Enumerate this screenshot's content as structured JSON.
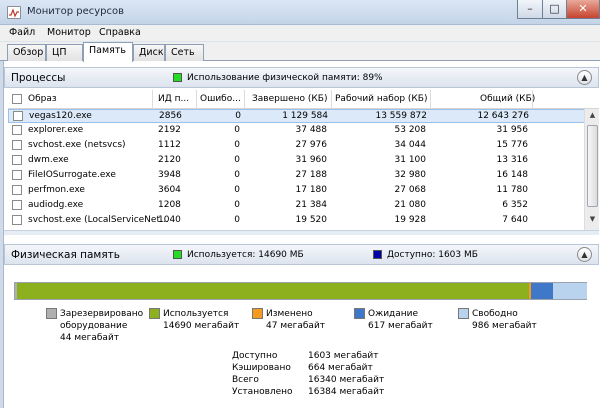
{
  "window": {
    "title": "Монитор ресурсов"
  },
  "menu": [
    "Файл",
    "Монитор",
    "Справка"
  ],
  "tabs": [
    "Обзор",
    "ЦП",
    "Память",
    "Диск",
    "Сеть"
  ],
  "processes": {
    "title": "Процессы",
    "usage_text": "Использование физической памяти: 89%",
    "usage_color": "#22dd22",
    "columns": [
      "Образ",
      "ИД п...",
      "Ошибо...",
      "Завершено (КБ)",
      "Рабочий набор (КБ)",
      "Общий (КБ)"
    ],
    "rows": [
      {
        "image": "vegas120.exe",
        "pid": "2856",
        "faults": "0",
        "commit": "1 129 584",
        "working": "13 559 872",
        "shareable": "12 643 276"
      },
      {
        "image": "explorer.exe",
        "pid": "2192",
        "faults": "0",
        "commit": "37 488",
        "working": "53 208",
        "shareable": "31 956"
      },
      {
        "image": "svchost.exe (netsvcs)",
        "pid": "1112",
        "faults": "0",
        "commit": "27 976",
        "working": "34 044",
        "shareable": "15 776"
      },
      {
        "image": "dwm.exe",
        "pid": "2120",
        "faults": "0",
        "commit": "31 960",
        "working": "31 100",
        "shareable": "13 316"
      },
      {
        "image": "FileIOSurrogate.exe",
        "pid": "3948",
        "faults": "0",
        "commit": "27 188",
        "working": "32 980",
        "shareable": "16 148"
      },
      {
        "image": "perfmon.exe",
        "pid": "3604",
        "faults": "0",
        "commit": "17 180",
        "working": "27 068",
        "shareable": "11 780"
      },
      {
        "image": "audiodg.exe",
        "pid": "1208",
        "faults": "0",
        "commit": "21 384",
        "working": "21 080",
        "shareable": "6 352"
      },
      {
        "image": "svchost.exe (LocalServiceNet...",
        "pid": "1040",
        "faults": "0",
        "commit": "19 520",
        "working": "19 928",
        "shareable": "7 640"
      }
    ]
  },
  "physical": {
    "title": "Физическая память",
    "used_text": "Используется: 14690 МБ",
    "used_color": "#22dd22",
    "avail_text": "Доступно: 1603 МБ",
    "avail_color": "#0000aa",
    "bar_mb": {
      "reserved": 44,
      "in_use": 14690,
      "modified": 47,
      "standby": 617,
      "free": 986
    },
    "legend": [
      {
        "label": "Зарезервировано",
        "label2": "оборудование",
        "value": "44 мегабайт",
        "color": "#b0b0b0"
      },
      {
        "label": "Используется",
        "value": "14690 мегабайт",
        "color": "#8cb01e"
      },
      {
        "label": "Изменено",
        "value": "47 мегабайт",
        "color": "#f39a1f"
      },
      {
        "label": "Ожидание",
        "value": "617 мегабайт",
        "color": "#3f78c9"
      },
      {
        "label": "Свободно",
        "value": "986 мегабайт",
        "color": "#b9d3ee"
      }
    ],
    "stats": [
      {
        "label": "Доступно",
        "value": "1603 мегабайт"
      },
      {
        "label": "Кэшировано",
        "value": "664 мегабайт"
      },
      {
        "label": "Всего",
        "value": "16340 мегабайт"
      },
      {
        "label": "Установлено",
        "value": "16384 мегабайт"
      }
    ]
  }
}
